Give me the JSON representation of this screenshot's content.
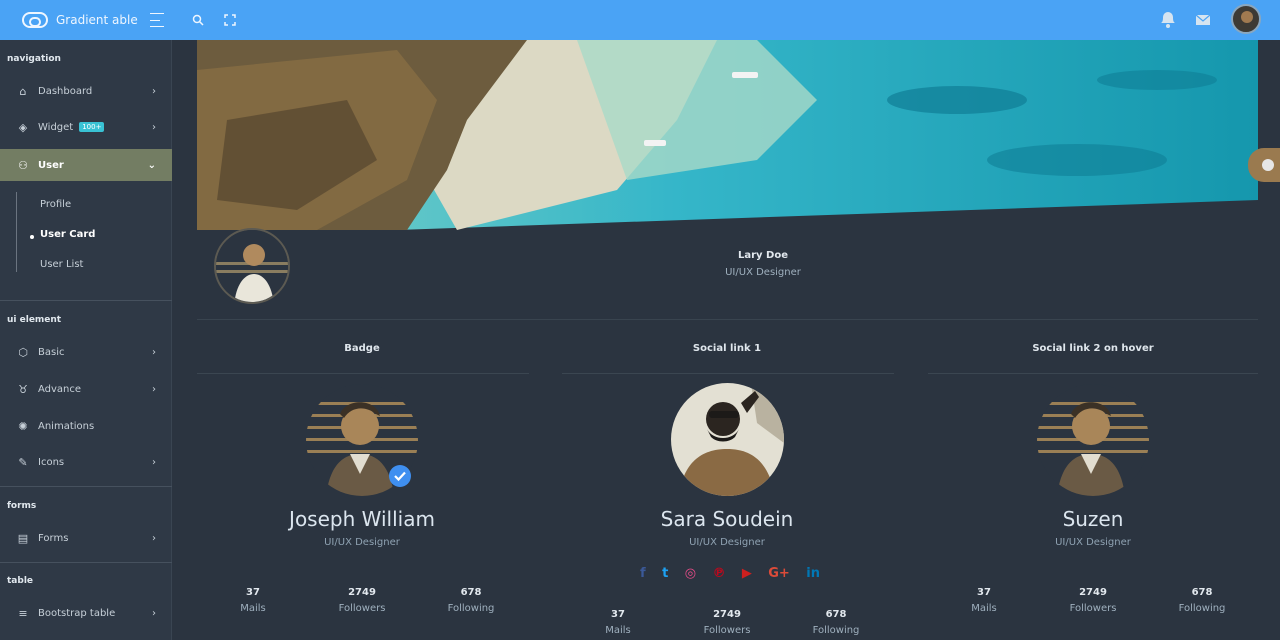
{
  "app": {
    "brand": "Gradient able"
  },
  "colors": {
    "topbar": "#4aa3f5",
    "sidebar_active": "#737d63",
    "background": "#2b3440"
  },
  "topbar": {
    "icons": [
      "menu-icon",
      "search-icon",
      "fullscreen-icon",
      "bell-icon",
      "mail-icon"
    ]
  },
  "sidebar": {
    "captions": [
      "navigation",
      "ui element",
      "forms",
      "table"
    ],
    "items": [
      {
        "label": "Dashboard",
        "icon": "home-icon"
      },
      {
        "label": "Widget",
        "icon": "layers-icon",
        "badge": "100+"
      },
      {
        "label": "User",
        "icon": "users-icon"
      },
      {
        "label": "Basic",
        "icon": "box-icon"
      },
      {
        "label": "Advance",
        "icon": "gitlab-icon"
      },
      {
        "label": "Animations",
        "icon": "aperture-icon"
      },
      {
        "label": "Icons",
        "icon": "feather-icon"
      },
      {
        "label": "Forms",
        "icon": "file-text-icon"
      },
      {
        "label": "Bootstrap table",
        "icon": "table-icon"
      }
    ],
    "user_sub": [
      "Profile",
      "User Card",
      "User List"
    ]
  },
  "profile": {
    "name": "Lary Doe",
    "role": "UI/UX Designer"
  },
  "cards": [
    {
      "title": "Badge",
      "name": "Joseph William",
      "role": "UI/UX Designer",
      "stats": [
        {
          "num": "37",
          "label": "Mails"
        },
        {
          "num": "2749",
          "label": "Followers"
        },
        {
          "num": "678",
          "label": "Following"
        }
      ]
    },
    {
      "title": "Social link 1",
      "name": "Sara Soudein",
      "role": "UI/UX Designer",
      "social": [
        "facebook-icon",
        "twitter-icon",
        "dribbble-icon",
        "pinterest-icon",
        "youtube-icon",
        "google-plus-icon",
        "linkedin-icon"
      ],
      "stats": [
        {
          "num": "37",
          "label": "Mails"
        },
        {
          "num": "2749",
          "label": "Followers"
        },
        {
          "num": "678",
          "label": "Following"
        }
      ]
    },
    {
      "title": "Social link 2 on hover",
      "name": "Suzen",
      "role": "UI/UX Designer",
      "stats": [
        {
          "num": "37",
          "label": "Mails"
        },
        {
          "num": "2749",
          "label": "Followers"
        },
        {
          "num": "678",
          "label": "Following"
        }
      ]
    }
  ]
}
